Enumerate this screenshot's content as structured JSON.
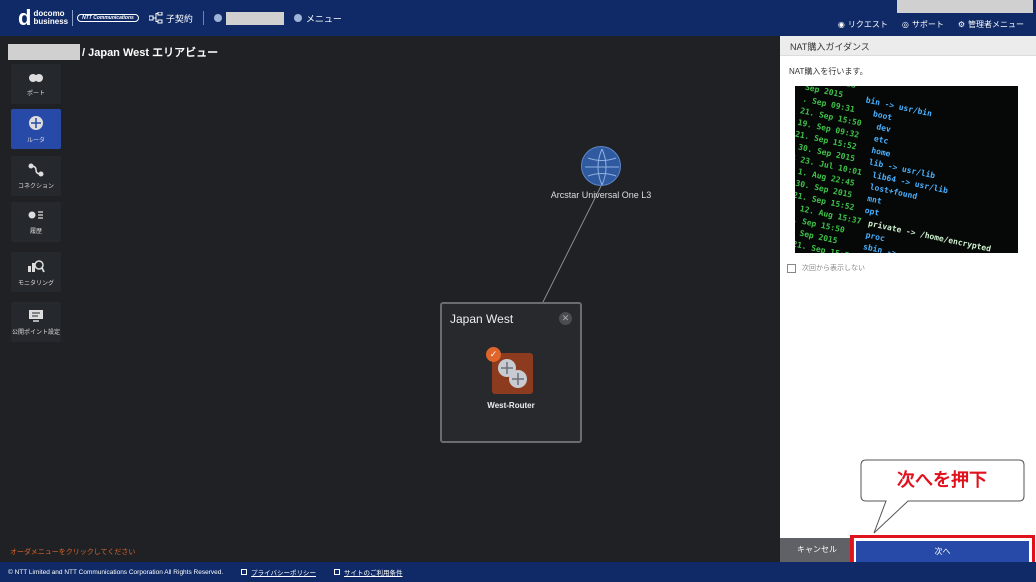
{
  "header": {
    "logo_mark": "d",
    "logo_text_1": "docomo",
    "logo_text_2": "business",
    "ntt_logo": "NTT Communications",
    "contract_label": "子契約",
    "menu_label": "メニュー",
    "links": {
      "request": "リクエスト",
      "support": "サポート",
      "admin_menu": "管理者メニュー"
    }
  },
  "breadcrumb": {
    "path": "/ Japan West エリアビュー"
  },
  "left_menu": {
    "items": [
      {
        "label": "ポート",
        "icon": "port-icon"
      },
      {
        "label": "ルータ",
        "icon": "router-icon"
      },
      {
        "label": "コネクション",
        "icon": "connection-icon"
      },
      {
        "label": "履歴",
        "icon": "history-icon"
      },
      {
        "label": "モニタリング",
        "icon": "monitoring-icon"
      },
      {
        "label": "公開ポイント設定",
        "icon": "public-point-icon"
      }
    ]
  },
  "bottom_hint": "オーダメニューをクリックしてください",
  "canvas": {
    "network_label": "Arcstar Universal One L3",
    "region_title": "Japan West",
    "router_label": "West-Router"
  },
  "panel": {
    "title": "NAT購入ガイダンス",
    "description": "NAT購入を行います。",
    "checkbox_label": "次回から表示しない",
    "cancel_label": "キャンセル",
    "next_label": "次へ"
  },
  "callout": {
    "text": "次へを押下"
  },
  "footer": {
    "copyright": "© NTT Limited and NTT Communications Corporation All Rights Reserved.",
    "privacy": "プライバシーポリシー",
    "terms": "サイトのご利用条件"
  },
  "colors": {
    "header_bg": "#0f2a66",
    "active_menu": "#274aa8",
    "accent_orange": "#e0652a",
    "callout_red": "#e0121e"
  }
}
